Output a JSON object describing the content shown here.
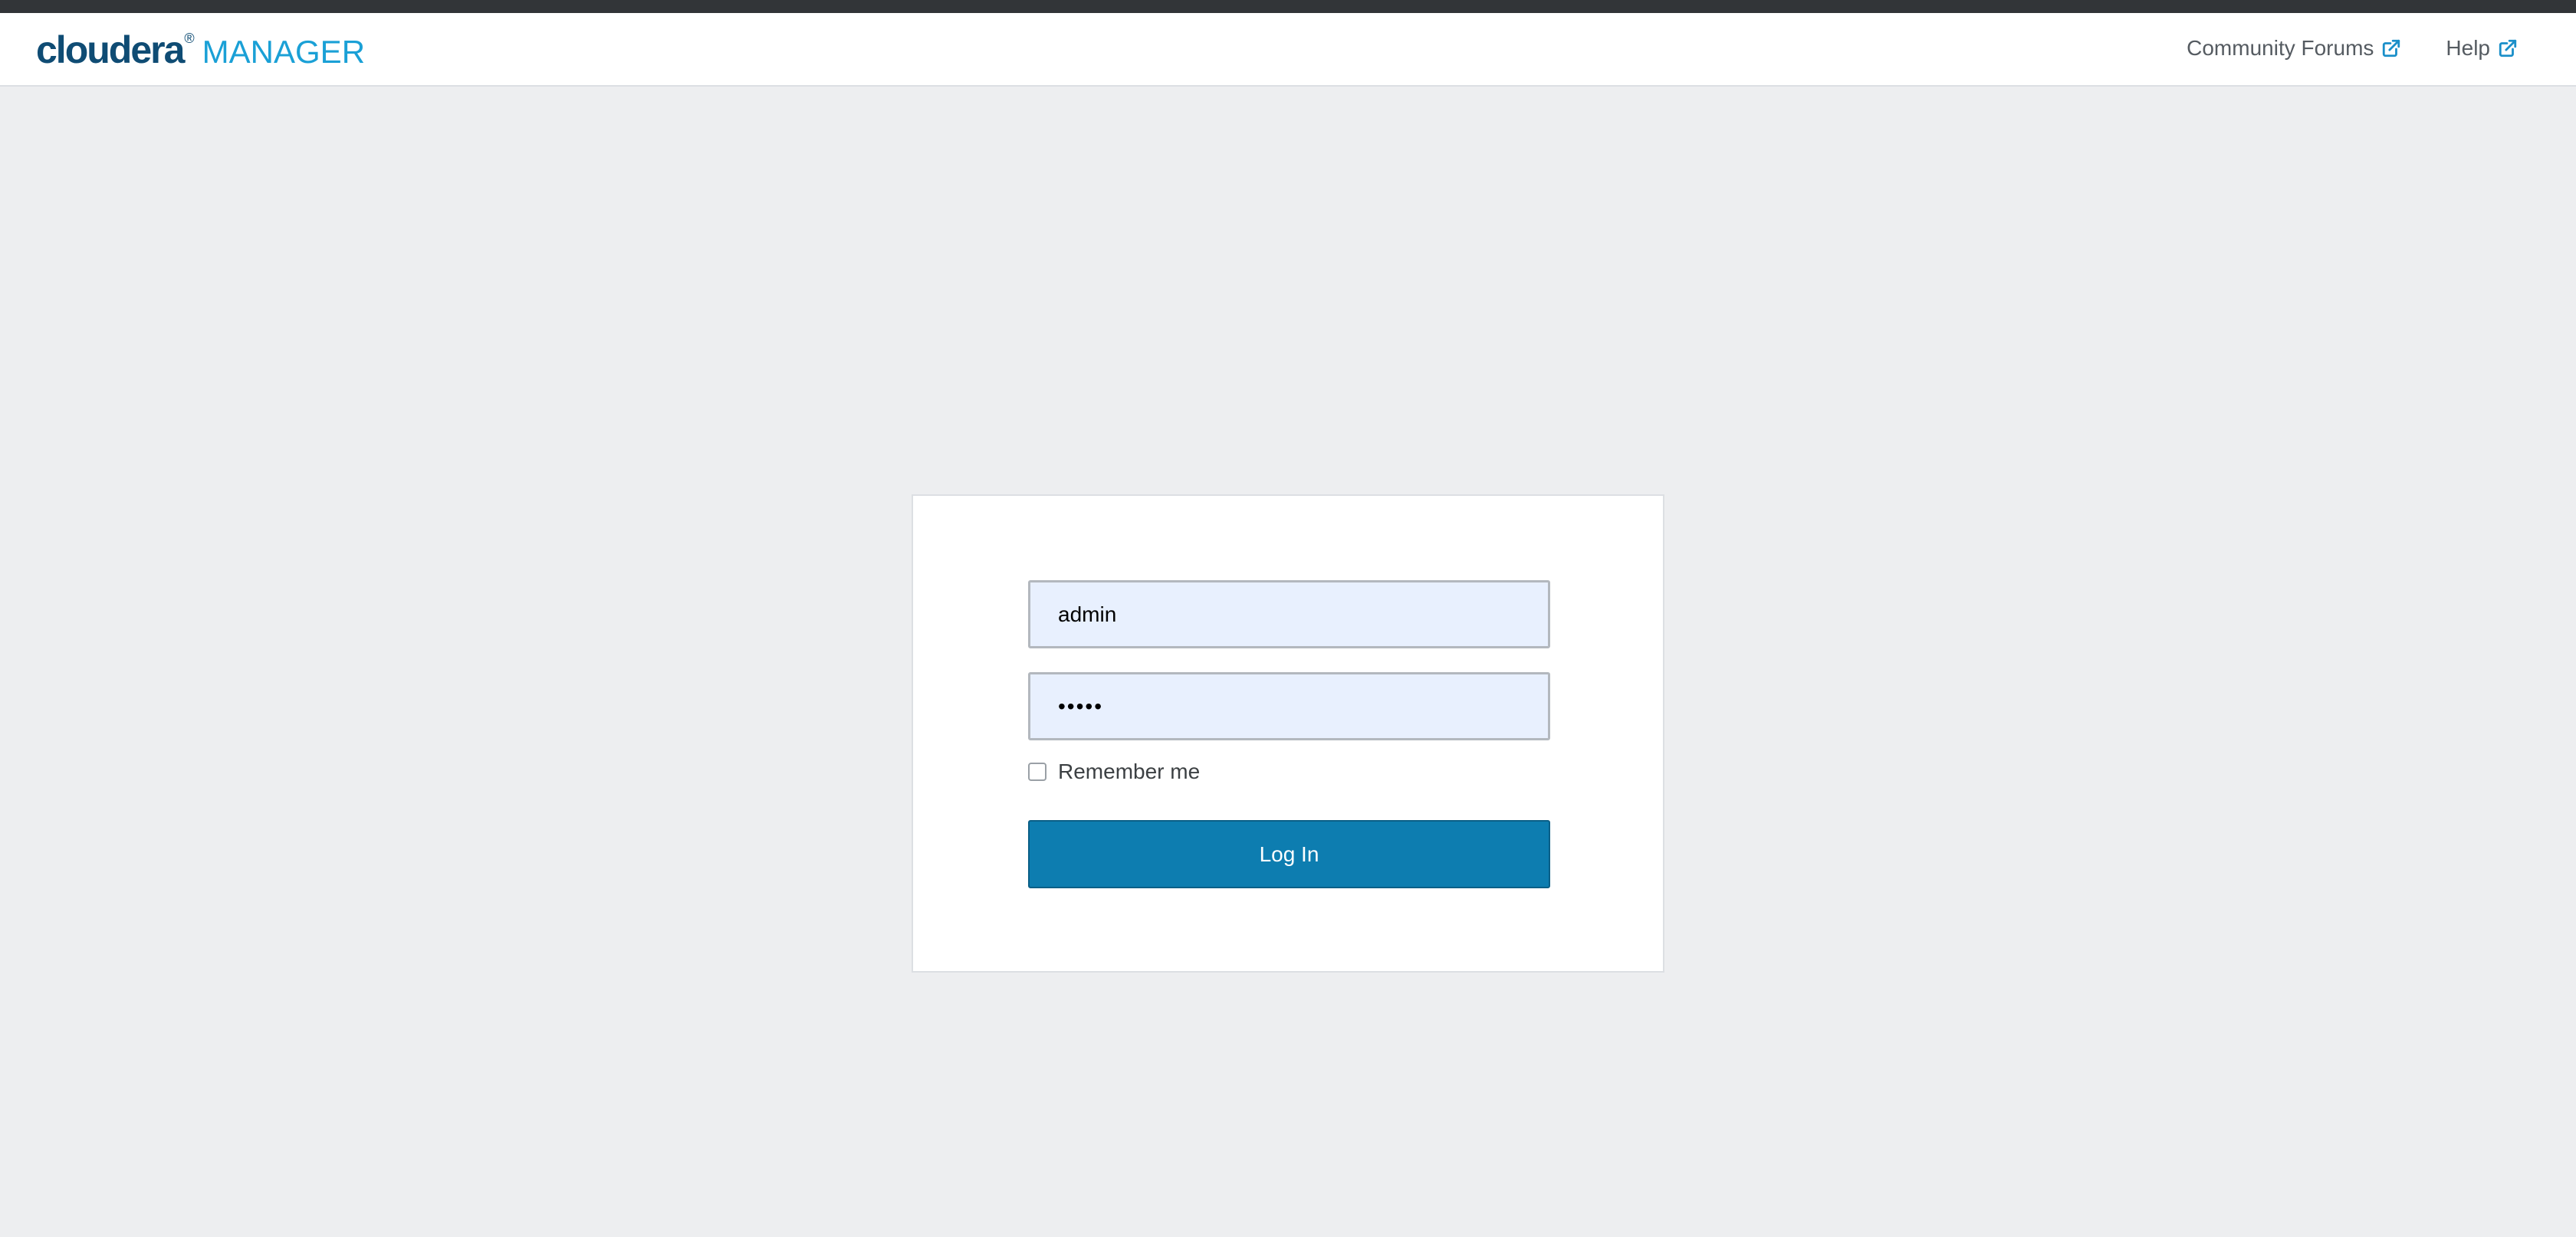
{
  "header": {
    "brand_primary": "cloudera",
    "brand_mark": "®",
    "brand_secondary": "MANAGER",
    "links": [
      {
        "label": "Community Forums",
        "icon": "external-link-icon"
      },
      {
        "label": "Help",
        "icon": "external-link-icon"
      }
    ]
  },
  "login": {
    "username_value": "admin",
    "password_value": "•••••",
    "remember_label": "Remember me",
    "remember_checked": false,
    "submit_label": "Log In"
  },
  "colors": {
    "brand_dark": "#0f4c74",
    "brand_light": "#1aa0d6",
    "primary_button": "#0d7db0",
    "page_background": "#edeef0",
    "input_autofill": "#e8f0fe",
    "link": "#1a8fc9"
  }
}
